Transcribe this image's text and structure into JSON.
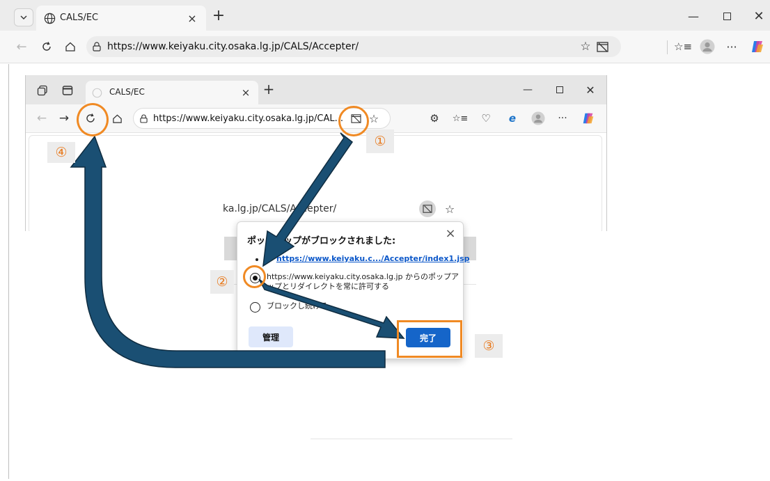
{
  "outer_browser": {
    "tab_title": "CALS/EC",
    "address": "https://www.keiyaku.city.osaka.lg.jp/CALS/Accepter/"
  },
  "inner_browser": {
    "tab_title": "CALS/EC",
    "address": "https://www.keiyaku.city.osaka.lg.jp/CAL..."
  },
  "background_page": {
    "url_fragment": "ka.lg.jp/CALS/Accepter/"
  },
  "popup": {
    "title": "ポップアップがブロックされました:",
    "blocked_link": "https://www.keiyaku.c.../Accepter/index1.jsp",
    "option_allow_line1": "https://www.keiyaku.city.osaka.lg.jp からのポップア",
    "option_allow_line2": "ップとリダイレクトを常に許可する",
    "option_block": "ブロックし続ける",
    "manage_label": "管理",
    "done_label": "完了"
  },
  "annotations": {
    "step1": "①",
    "step2": "②",
    "step3": "③",
    "step4": "④",
    "arrow_color": "#1a4f73",
    "highlight_color": "#f08a24"
  }
}
